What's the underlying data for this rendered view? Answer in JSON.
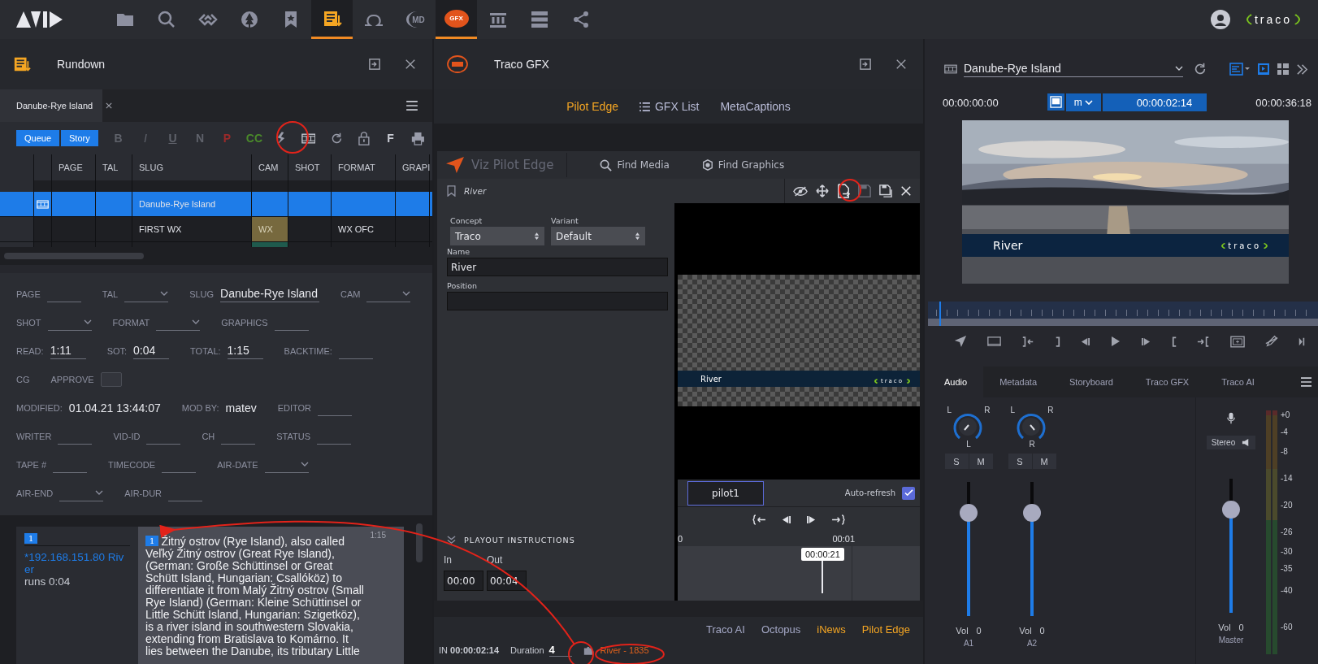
{
  "topbar": {
    "apps": [
      {
        "selected": false
      },
      {
        "selected": false
      },
      {
        "selected": false
      },
      {
        "selected": false
      },
      {
        "selected": false
      },
      {
        "selected": true
      },
      {
        "selected": false
      },
      {
        "selected": false,
        "label": "MD"
      },
      {
        "selected": true,
        "label": "GFX"
      },
      {
        "selected": false
      },
      {
        "selected": false
      },
      {
        "selected": false
      }
    ],
    "brand_logo": "traco"
  },
  "rundown": {
    "title": "Rundown",
    "tabs": [
      {
        "label": "Danube-Rye Island",
        "selected": true
      }
    ],
    "modes": [
      {
        "label": "Queue",
        "selected": true
      },
      {
        "label": "Story",
        "selected": true
      }
    ],
    "toolbar": [
      {
        "kind": "text",
        "label": "B",
        "color": "#5f626b"
      },
      {
        "kind": "text",
        "label": "I",
        "color": "#5f626b"
      },
      {
        "kind": "text",
        "label": "U",
        "color": "#5f626b"
      },
      {
        "kind": "text",
        "label": "N",
        "color": "#5f626b"
      },
      {
        "kind": "text",
        "label": "P",
        "color": "#9b2a2a"
      },
      {
        "kind": "text",
        "label": "CC",
        "color": "#4a8a2a"
      },
      {
        "kind": "icon"
      },
      {
        "kind": "icon"
      },
      {
        "kind": "icon"
      },
      {
        "kind": "icon"
      },
      {
        "kind": "text",
        "label": "F",
        "color": "#c9ccd4"
      },
      {
        "kind": "icon"
      }
    ],
    "columns": [
      "PAGE",
      "TAL",
      "SLUG",
      "CAM",
      "SHOT",
      "FORMAT",
      "GRAPI"
    ],
    "rows": [
      {
        "selected": true,
        "story_icon": true,
        "slug": "Danube-Rye Island"
      },
      {
        "selected": false,
        "story_icon": false,
        "slug": "FIRST WX",
        "cam": {
          "label": "WX",
          "color": "#77693e"
        },
        "format": "WX OFC"
      }
    ],
    "form": [
      [
        {
          "kind": "text",
          "label": "PAGE"
        },
        {
          "kind": "dropdown",
          "label": "TAL"
        },
        {
          "kind": "text",
          "label": "SLUG",
          "value": "Danube-Rye Island"
        },
        {
          "kind": "dropdown",
          "label": "CAM"
        }
      ],
      [
        {
          "kind": "dropdown",
          "label": "SHOT"
        },
        {
          "kind": "dropdown",
          "label": "FORMAT"
        },
        {
          "kind": "text",
          "label": "GRAPHICS"
        }
      ],
      [
        {
          "kind": "text",
          "label": "READ:",
          "value": "1:11"
        },
        {
          "kind": "text",
          "label": "SOT:",
          "value": "0:04"
        },
        {
          "kind": "text",
          "label": "TOTAL:",
          "value": "1:15"
        },
        {
          "kind": "text",
          "label": "BACKTIME:"
        }
      ],
      [
        {
          "kind": "label",
          "label": "CG"
        },
        {
          "kind": "checkbox",
          "label": "APPROVE",
          "checked": false
        }
      ],
      [
        {
          "kind": "readonly",
          "label": "MODIFIED:",
          "value": "01.04.21 13:44:07"
        },
        {
          "kind": "readonly",
          "label": "MOD BY:",
          "value": "matev"
        },
        {
          "kind": "text",
          "label": "EDITOR"
        }
      ],
      [
        {
          "kind": "text",
          "label": "WRITER"
        },
        {
          "kind": "text",
          "label": "VID-ID"
        },
        {
          "kind": "text",
          "label": "CH"
        },
        {
          "kind": "text",
          "label": "STATUS"
        }
      ],
      [
        {
          "kind": "text",
          "label": "TAPE #"
        },
        {
          "kind": "text",
          "label": "TIMECODE"
        },
        {
          "kind": "dropdown",
          "label": "AIR-DATE"
        }
      ],
      [
        {
          "kind": "dropdown",
          "label": "AIR-END"
        },
        {
          "kind": "text",
          "label": "AIR-DUR"
        }
      ]
    ],
    "script": {
      "cue": {
        "number": "1",
        "link": "*192.168.151.80 River",
        "runs": "runs 0:04"
      },
      "text": {
        "number": "1",
        "time": "1:15",
        "body": "Žitný ostrov (Rye Island), also called Veľký Žitný ostrov (Great Rye Island), (German: Große Schüttinsel or Great Schütt Island, Hungarian: Csallóköz) to differentiate it from Malý Žitný ostrov (Small Rye Island) (German: Kleine Schüttinsel or Little Schütt Island, Hungarian: Szigetköz), is a river island in southwestern Slovakia, extending from Bratislava to Komárno. It lies between the Danube, its tributary Little"
      }
    }
  },
  "gfx": {
    "title": "Traco GFX",
    "tabs": [
      {
        "label": "Pilot Edge",
        "selected": true
      },
      {
        "label": "GFX List",
        "selected": false
      },
      {
        "label": "MetaCaptions",
        "selected": false
      }
    ],
    "pilot": {
      "brand": "Viz Pilot Edge",
      "tabs": [
        {
          "label": "Find Media"
        },
        {
          "label": "Find Graphics"
        }
      ],
      "template": "River",
      "concept": {
        "label": "Concept",
        "value": "Traco"
      },
      "variant": {
        "label": "Variant",
        "value": "Default"
      },
      "name": {
        "label": "Name",
        "value": "River"
      },
      "position": {
        "label": "Position"
      },
      "preview": {
        "caption": "River",
        "logo": "traco"
      },
      "channel": "pilot1",
      "auto_refresh": {
        "label": "Auto-refresh",
        "checked": true
      },
      "ruler": [
        "0",
        "00:01"
      ],
      "playhead": "00:00:21",
      "playout": {
        "title": "PLAYOUT INSTRUCTIONS",
        "in": {
          "label": "In",
          "value": "00:00"
        },
        "out": {
          "label": "Out",
          "value": "00:04"
        }
      }
    },
    "footer": {
      "sources": [
        {
          "label": "Traco AI",
          "selected": false
        },
        {
          "label": "Octopus",
          "selected": false
        },
        {
          "label": "iNews",
          "selected": true
        },
        {
          "label": "Pilot Edge",
          "selected": true
        }
      ],
      "in": "IN **00:00:02:14**",
      "duration_label": "Duration",
      "duration": "4",
      "element": "River - 1835"
    }
  },
  "player": {
    "title": "Danube-Rye Island",
    "mark_in": "00:00:00:00",
    "mode": "m",
    "position": "00:00:02:14",
    "mark_out": "00:00:36:18",
    "caption": "River",
    "logo": "traco",
    "scrub": {
      "level": 0.03
    },
    "tabs": [
      {
        "label": "Audio",
        "selected": true
      },
      {
        "label": "Metadata",
        "selected": false
      },
      {
        "label": "Storyboard",
        "selected": false
      },
      {
        "label": "Traco GFX",
        "selected": false
      },
      {
        "label": "Traco AI",
        "selected": false
      }
    ],
    "channels": [
      {
        "name": "A1",
        "left": "L",
        "right": "R",
        "pan": "L",
        "solo": "S",
        "mute": "M",
        "vol_label": "Vol",
        "vol": "0",
        "level": 0.77
      },
      {
        "name": "A2",
        "left": "L",
        "right": "R",
        "pan": "R",
        "solo": "S",
        "mute": "M",
        "vol_label": "Vol",
        "vol": "0",
        "level": 0.77
      }
    ],
    "master": {
      "name": "Master",
      "mode": "Stereo",
      "vol_label": "Vol",
      "vol": "0",
      "level": 0.77
    },
    "meter_scale": [
      "+0",
      "-4",
      "-8",
      "-14",
      "-20",
      "-26",
      "-30",
      "-35",
      "-40",
      "-60"
    ]
  }
}
